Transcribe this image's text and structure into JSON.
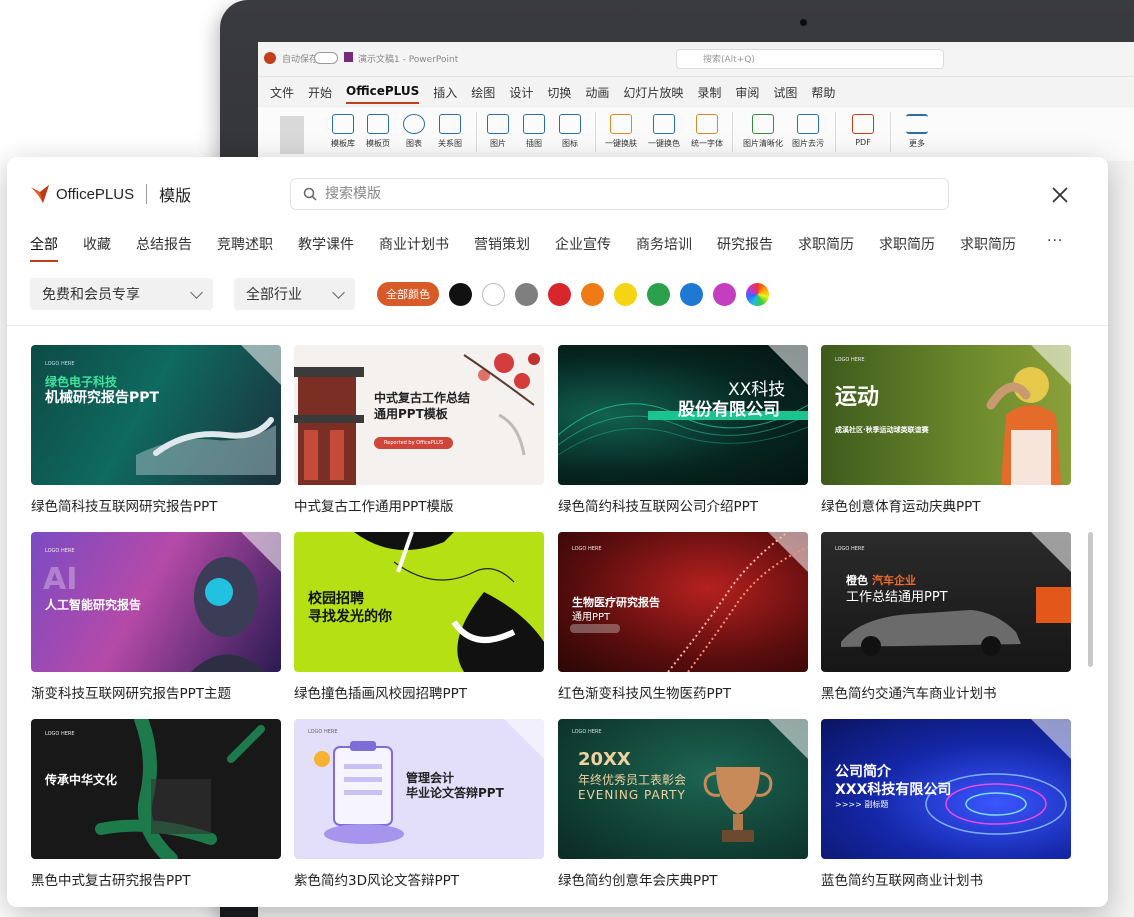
{
  "powerpoint": {
    "autosave": "自动保存",
    "doc_name": "演示文稿1 - PowerPoint",
    "search_placeholder": "搜索(Alt+Q)",
    "tabs": [
      "文件",
      "开始",
      "OfficePLUS",
      "插入",
      "绘图",
      "设计",
      "切换",
      "动画",
      "幻灯片放映",
      "录制",
      "审阅",
      "试图",
      "帮助"
    ],
    "ribbon": [
      "模板库",
      "模板页",
      "图表",
      "关系图",
      "图片",
      "插图",
      "图标",
      "一键换肤",
      "一键换色",
      "统一字体",
      "图片清晰化",
      "图片去污",
      "PDF",
      "更多"
    ]
  },
  "dialog": {
    "brand": "OfficePLUS",
    "section": "模版",
    "search_placeholder": "搜索模版",
    "categories": [
      "全部",
      "收藏",
      "总结报告",
      "竞聘述职",
      "教学课件",
      "商业计划书",
      "营销策划",
      "企业宣传",
      "商务培训",
      "研究报告",
      "求职简历",
      "求职简历",
      "求职简历"
    ],
    "more": "···",
    "filter_license": "免费和会员专享",
    "filter_industry": "全部行业",
    "color_all": "全部颜色",
    "swatches": [
      "#111111",
      "#ffffff",
      "#7f7f7f",
      "#d9262c",
      "#f07a16",
      "#f5d513",
      "#2aa14a",
      "#1f78d1",
      "#c33fc0",
      "rainbow"
    ]
  },
  "templates": [
    {
      "title": "绿色简科技互联网研究报告PPT",
      "line1": "绿色电子科技",
      "line2": "机械研究报告PPT",
      "logo": "LOGO HERE"
    },
    {
      "title": "中式复古工作通用PPT模版",
      "line1": "中式复古工作总结",
      "line2": "通用PPT模板",
      "button": "Reported by OfficePLUS"
    },
    {
      "title": "绿色简约科技互联网公司介绍PPT",
      "line1": "XX科技",
      "line2": "股份有限公司"
    },
    {
      "title": "绿色创意体育运动庆典PPT",
      "line1": "运动",
      "line2": "成溪社区·秋季运动球类联谊赛",
      "logo": "LOGO HERE"
    },
    {
      "title": "渐变科技互联网研究报告PPT主题",
      "line1": "AI",
      "line2": "人工智能研究报告",
      "logo": "LOGO HERE"
    },
    {
      "title": "绿色撞色插画风校园招聘PPT",
      "line1": "校园招聘",
      "line2": "寻找发光的你"
    },
    {
      "title": "红色渐变科技风生物医药PPT",
      "line1": "生物医疗研究报告",
      "line2": "通用PPT",
      "logo": "LOGO HERE"
    },
    {
      "title": "黑色简约交通汽车商业计划书",
      "line1": "橙色",
      "line1b": "汽车企业",
      "line2": "工作总结通用PPT",
      "logo": "LOGO HERE"
    },
    {
      "title": "黑色中式复古研究报告PPT",
      "line1": "传承中华文化",
      "logo": "LOGO HERE"
    },
    {
      "title": "紫色简约3D风论文答辩PPT",
      "line1": "管理会计",
      "line2": "毕业论文答辩PPT",
      "logo": "LOGO HERE"
    },
    {
      "title": "绿色简约创意年会庆典PPT",
      "line1": "20XX",
      "line2": "年终优秀员工表彰会",
      "line3": "EVENING PARTY",
      "logo": "LOGO HERE"
    },
    {
      "title": "蓝色简约互联网商业计划书",
      "line1": "公司简介",
      "line2": "XXX科技有限公司",
      "line3": ">>>> 副标题"
    }
  ]
}
